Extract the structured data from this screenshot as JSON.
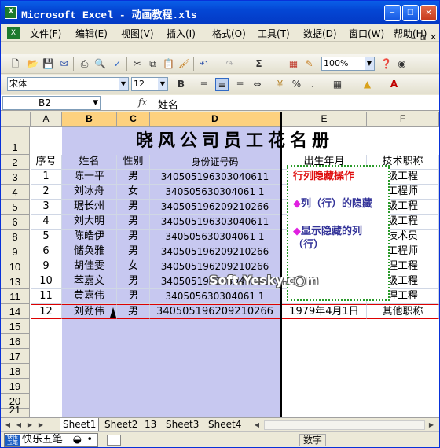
{
  "window": {
    "title": "Microsoft Excel - 动画教程.xls"
  },
  "menu": [
    "文件(F)",
    "编辑(E)",
    "视图(V)",
    "插入(I)",
    "格式(O)",
    "工具(T)",
    "数据(D)",
    "窗口(W)",
    "帮助(H)"
  ],
  "toolbar": {
    "zoom": "100%",
    "font": "宋体",
    "font_size": "12"
  },
  "formula_bar": {
    "name_box": "B2",
    "fx": "fx",
    "content": "姓名"
  },
  "columns": [
    "A",
    "B",
    "C",
    "D",
    "E",
    "F"
  ],
  "rows": [
    "1",
    "2",
    "3",
    "4",
    "5",
    "6",
    "8",
    "9",
    "10",
    "13",
    "11",
    "14",
    "15",
    "16",
    "17",
    "18",
    "19",
    "20",
    "21"
  ],
  "sheet_title": "晓风公司员工花名册",
  "headers": [
    "序号",
    "姓名",
    "性别",
    "身份证号码",
    "出生年月",
    "技术职称"
  ],
  "records": [
    [
      "1",
      "陈一平",
      "男",
      "340505196303040611",
      "",
      "级工程"
    ],
    [
      "2",
      "刘冰舟",
      "女",
      "340505630304061 1",
      "",
      "工程师"
    ],
    [
      "3",
      "琚长州",
      "男",
      "340505196209210266",
      "",
      "级工程"
    ],
    [
      "4",
      "刘大明",
      "男",
      "340505196303040611",
      "",
      "级工程"
    ],
    [
      "5",
      "陈皓伊",
      "男",
      "340505630304061 1",
      "",
      "技术员"
    ],
    [
      "6",
      "储奂雅",
      "男",
      "340505196209210266",
      "",
      "工程师"
    ],
    [
      "9",
      "胡佳雯",
      "女",
      "340505196209210266",
      "",
      "理工程"
    ],
    [
      "10",
      "苯嘉文",
      "男",
      "340505196303040611",
      "",
      "级工程"
    ],
    [
      "11",
      "黄嘉伟",
      "男",
      "340505630304061 1",
      "",
      "理工程"
    ],
    [
      "12",
      "刘劲伟",
      "男",
      "340505196209210266",
      "1979年4月1日",
      "其他职称"
    ]
  ],
  "popup": {
    "title": "行列隐藏操作",
    "item1": "列（行）的隐藏",
    "item2": "显示隐藏的列（行）",
    "bullet": "◆"
  },
  "watermark": "Soft.Yesky.c◉m",
  "sheets": [
    "Sheet1",
    "Sheet2",
    "13",
    "Sheet3",
    "Sheet4"
  ],
  "status": {
    "ime": "快乐五笔",
    "mode": "数字"
  },
  "colors": {
    "selection": "#c7c8f0",
    "popup_border": "#2a9a2a",
    "title_bar": "#0446d4"
  }
}
